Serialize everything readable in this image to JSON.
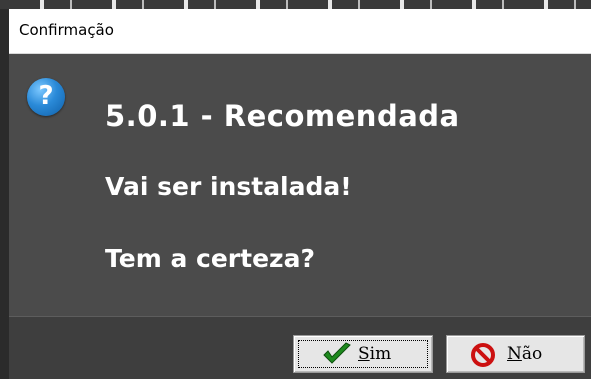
{
  "window": {
    "title": "Confirmação"
  },
  "message": {
    "line1": "5.0.1 - Recomendada",
    "line2": "Vai ser instalada!",
    "line3": "Tem a certeza?"
  },
  "buttons": {
    "yes_label": "Sim",
    "no_label": "Não"
  },
  "icons": {
    "dialog_icon": "question-icon",
    "yes_icon": "checkmark-icon",
    "no_icon": "no-entry-icon"
  },
  "colors": {
    "client_background": "#4b4b4b",
    "message_text": "#ffffff",
    "question_icon": "#2a8ad8",
    "checkmark": "#1e8a1e",
    "no_entry": "#cc1010"
  }
}
